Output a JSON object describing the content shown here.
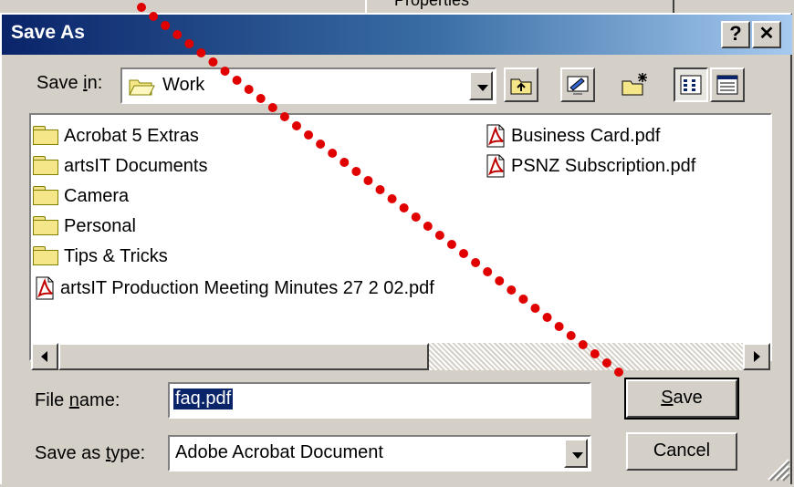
{
  "background": {
    "menu_item": "Properties"
  },
  "dialog": {
    "title": "Save As",
    "help_button": "?",
    "close_button": "✕",
    "save_in_label_pre": "Save ",
    "save_in_label_key": "i",
    "save_in_label_post": "n:",
    "save_in_value": "Work",
    "toolbar": [
      "up-one-level",
      "desktop",
      "create-new-folder",
      "list-view",
      "details-view"
    ],
    "folders": [
      "Acrobat 5 Extras",
      "artsIT Documents",
      "Camera",
      "Personal",
      "Tips & Tricks"
    ],
    "files_col1": [
      "artsIT Production Meeting Minutes 27 2 02.pdf"
    ],
    "files_col2": [
      "Business Card.pdf",
      "PSNZ Subscription.pdf"
    ],
    "file_name_label_pre": "File ",
    "file_name_label_key": "n",
    "file_name_label_post": "ame:",
    "file_name_value": "faq.pdf",
    "save_type_label_pre": "Save as ",
    "save_type_label_key": "t",
    "save_type_label_post": "ype:",
    "save_type_value": "Adobe Acrobat Document",
    "save_button_key": "S",
    "save_button_rest": "ave",
    "cancel_button": "Cancel"
  },
  "colors": {
    "titlebar_start": "#0a246a",
    "titlebar_end": "#a6caf0",
    "selection": "#0a246a",
    "dots": "#e00000"
  }
}
